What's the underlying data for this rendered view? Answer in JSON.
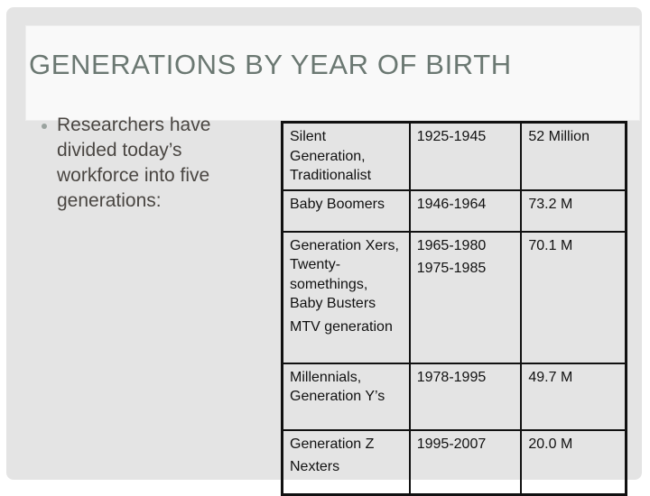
{
  "slide": {
    "title": "GENERATIONS BY YEAR OF BIRTH",
    "bullets": [
      "Researchers have divided today’s workforce into five generations:"
    ]
  },
  "table": {
    "rows": [
      {
        "name": [
          "Silent Generation, Traditionalist"
        ],
        "years": [
          "1925-1945"
        ],
        "population": "52 Million"
      },
      {
        "name": [
          "Baby Boomers"
        ],
        "years": [
          "1946-1964"
        ],
        "population": "73.2 M"
      },
      {
        "name": [
          "Generation Xers, Twenty-somethings, Baby Busters",
          "MTV generation"
        ],
        "years": [
          "1965-1980",
          "1975-1985"
        ],
        "population": "70.1 M"
      },
      {
        "name": [
          "Millennials, Generation Y’s"
        ],
        "years": [
          "1978-1995"
        ],
        "population": "49.7 M"
      },
      {
        "name": [
          "Generation Z",
          "Nexters"
        ],
        "years": [
          "1995-2007"
        ],
        "population": "20.0 M"
      }
    ]
  }
}
